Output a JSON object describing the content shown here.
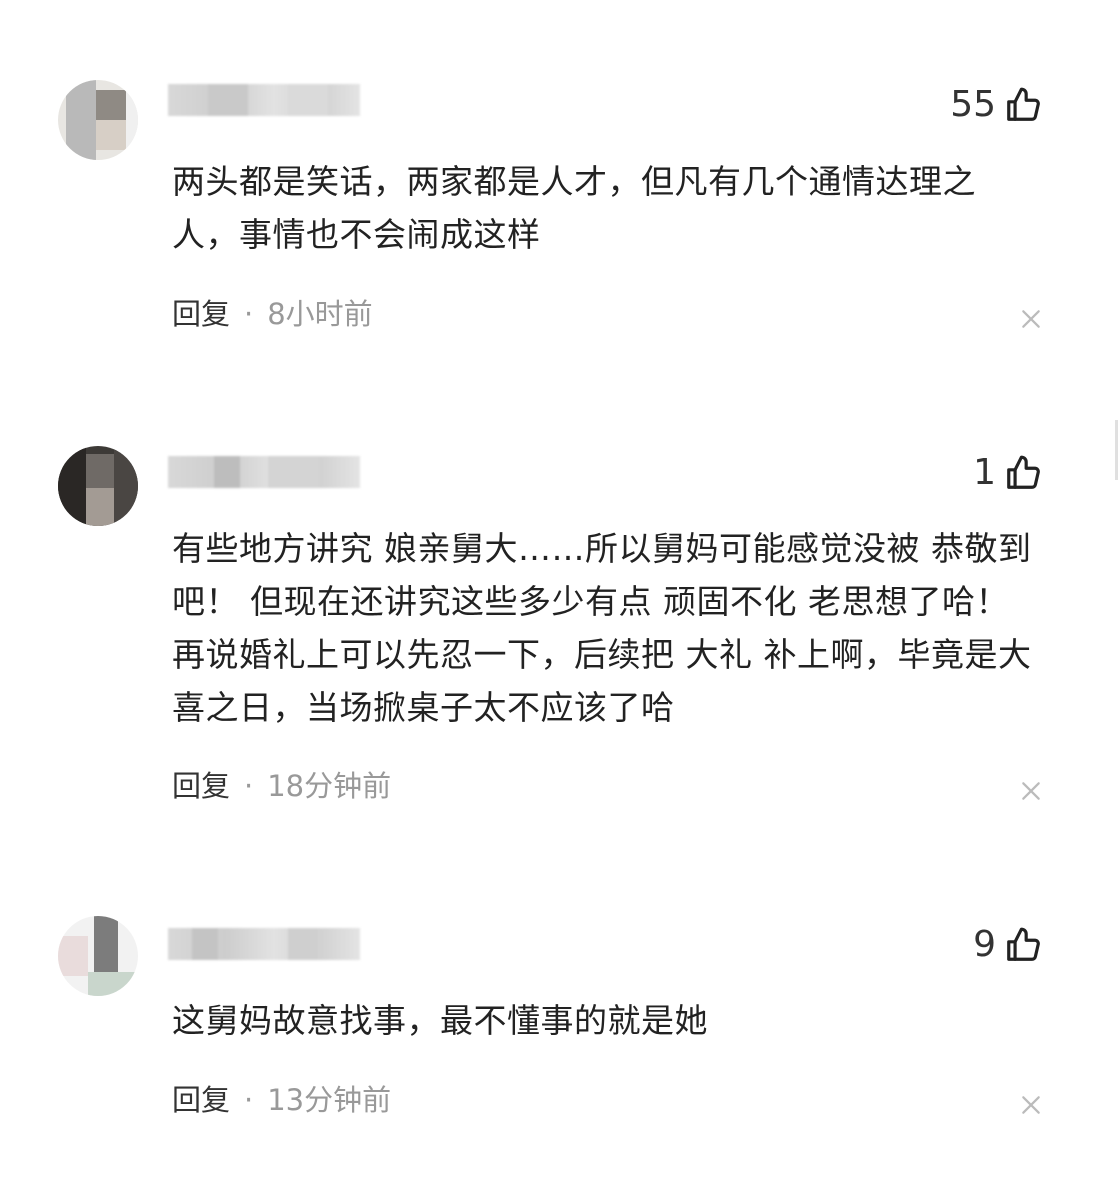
{
  "comments": [
    {
      "likes": "55",
      "text": "两头都是笑话，两家都是人才，但凡有几个通情达理之人，事情也不会闹成这样",
      "reply_label": "回复",
      "separator": "·",
      "time": "8小时前"
    },
    {
      "likes": "1",
      "text": "有些地方讲究 娘亲舅大……所以舅妈可能感觉没被 恭敬到吧！ 但现在还讲究这些多少有点 顽固不化 老思想了哈！ 再说婚礼上可以先忍一下，后续把 大礼 补上啊，毕竟是大喜之日，当场掀桌子太不应该了哈",
      "reply_label": "回复",
      "separator": "·",
      "time": "18分钟前"
    },
    {
      "likes": "9",
      "text": "这舅妈故意找事，最不懂事的就是她",
      "reply_label": "回复",
      "separator": "·",
      "time": "13分钟前"
    }
  ],
  "icons": {
    "like": "thumbs-up-icon",
    "close": "close-icon"
  },
  "colors": {
    "text": "#222222",
    "meta": "#999999",
    "reply": "#333333"
  }
}
